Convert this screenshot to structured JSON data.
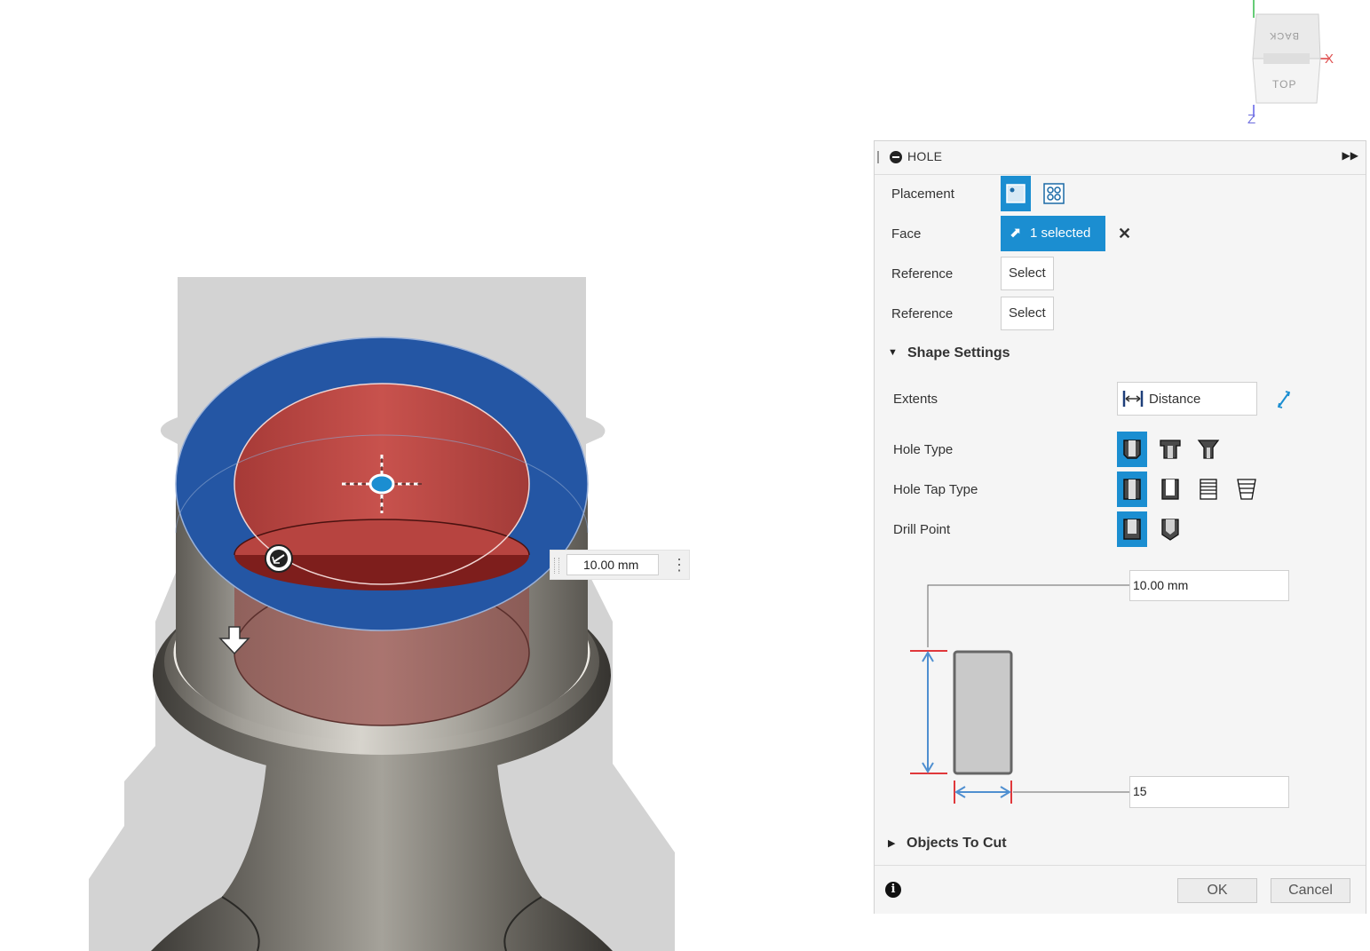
{
  "viewcube": {
    "face_top": "TOP",
    "face_back": "BACK",
    "axis_x": "X",
    "axis_z": "Z"
  },
  "viewport": {
    "dimension_value": "10.00 mm"
  },
  "panel": {
    "title": "HOLE",
    "placement_label": "Placement",
    "face_label": "Face",
    "face_value": "1 selected",
    "reference1_label": "Reference",
    "reference1_button": "Select",
    "reference2_label": "Reference",
    "reference2_button": "Select",
    "shape_settings_title": "Shape Settings",
    "extents_label": "Extents",
    "extents_value": "Distance",
    "hole_type_label": "Hole Type",
    "hole_tap_type_label": "Hole Tap Type",
    "drill_point_label": "Drill Point",
    "depth_value": "10.00 mm",
    "diameter_value": "15",
    "objects_to_cut_title": "Objects To Cut",
    "ok_label": "OK",
    "cancel_label": "Cancel"
  },
  "colors": {
    "accent": "#1b8ed1",
    "face_blue": "#2456a4",
    "hole_red": "#b8433f",
    "shadow": "#d3d3d3"
  }
}
